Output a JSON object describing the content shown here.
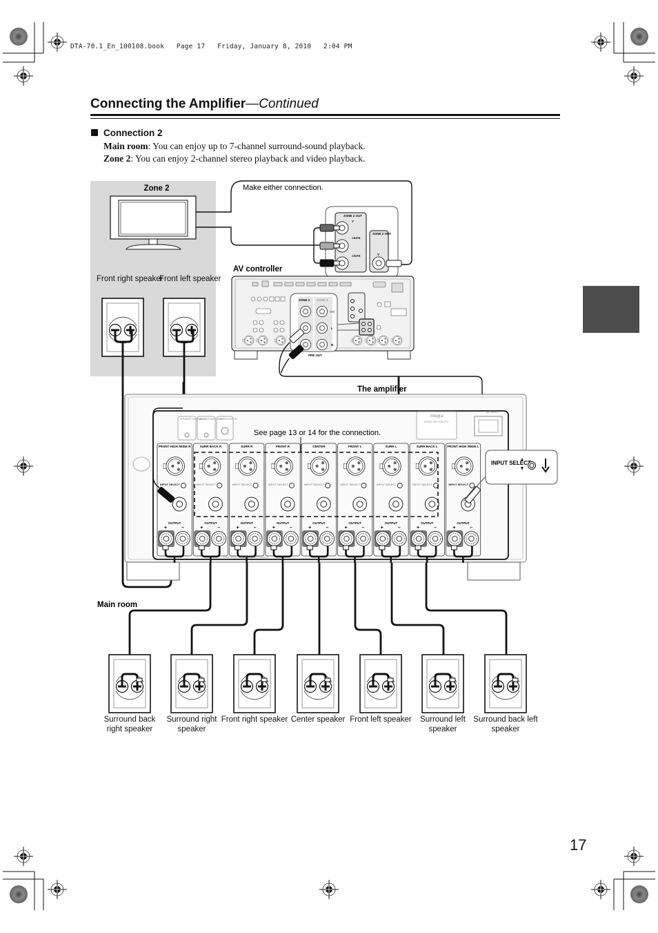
{
  "print_header": {
    "file": "DTA-70.1_En_100108.book",
    "page": "Page 17",
    "date": "Friday, January 8, 2010",
    "time": "2:04 PM"
  },
  "page": {
    "title": "Connecting the Amplifier",
    "title_suffix": "—Continued",
    "number": "17"
  },
  "section": {
    "heading": "Connection 2",
    "lines": [
      {
        "term": "Main room",
        "text": ": You can enjoy up to 7-channel surround-sound playback."
      },
      {
        "term": "Zone 2",
        "text": ": You can enjoy 2-channel stereo playback and video playback."
      }
    ]
  },
  "diagram": {
    "zone2": {
      "label": "Zone 2",
      "speakers": [
        "Front right speaker",
        "Front left speaker"
      ]
    },
    "make_either_connection": "Make either connection.",
    "av_controller_label": "AV controller",
    "av_controller_jacks": {
      "component_out": "ZONE 2 OUT",
      "component_y": "Y",
      "component_cb": "CB/PB",
      "component_cr": "CR/PR",
      "composite_out": "ZONE 2 OUT",
      "composite_v": "V",
      "preout_zone2": "ZONE 2",
      "preout_zone3": "ZONE 3",
      "preout_sw": "SW",
      "preout_l": "L",
      "preout_r": "R",
      "preout_label": "PRE OUT"
    },
    "amplifier_label": "The amplifier",
    "see_page": "See page 13 or 14 for the connection.",
    "amp_top": {
      "speaker_impedance": "SPEAKER IMPEDANCE",
      "auto_power_down": "AUTO POWER DOWN",
      "trigger_in": "12V TRIGGER IN",
      "ac_inlet": "AC INLET",
      "brand": "Integra",
      "model": "MODEL NO. DTA-70.1"
    },
    "amp_channels": [
      "FRONT HIGH /WIDE R",
      "SURR BACK R",
      "SURR R",
      "FRONT R",
      "CENTER",
      "FRONT L",
      "SURR L",
      "SURR BACK L",
      "FRONT HIGH /WIDE L"
    ],
    "input_select": "INPUT SELECT",
    "output_label": "OUTPUT",
    "plus": "+",
    "minus": "–",
    "caution": "CAUTION : SPEAKER IMPEDANCE",
    "callout_input_select": "INPUT SELECT",
    "main_room_label": "Main room",
    "main_speakers": [
      "Surround back right speaker",
      "Surround right speaker",
      "Front right speaker",
      "Center speaker",
      "Front left speaker",
      "Surround left speaker",
      "Surround back left speaker"
    ]
  },
  "colors": {
    "zone_bg": "#d9d9d9",
    "side_tab": "#4d4d4d",
    "panel_fill": "#f2f2f2",
    "line": "#1a1a1a"
  }
}
